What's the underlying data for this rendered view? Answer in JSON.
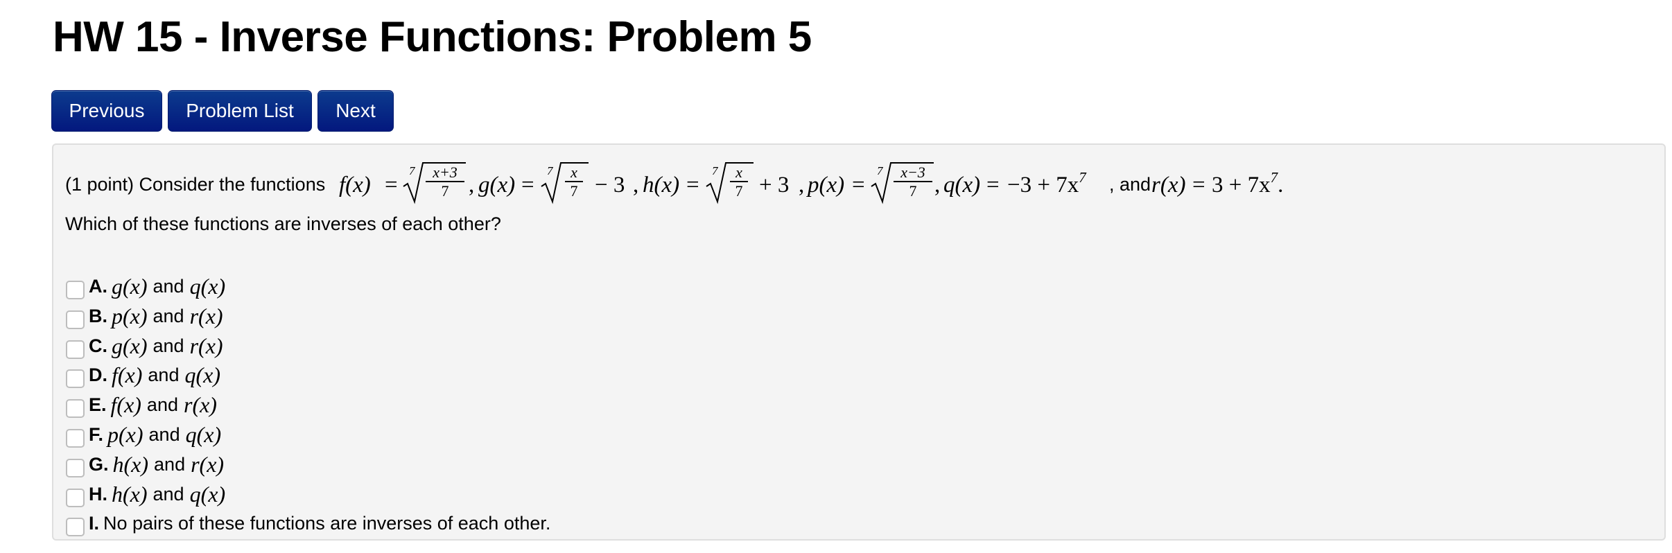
{
  "page_title": "HW 15 - Inverse Functions: Problem 5",
  "nav": {
    "previous_label": "Previous",
    "problem_list_label": "Problem List",
    "next_label": "Next",
    "button_color": "#0a2a86"
  },
  "problem": {
    "intro": "(1 point) Consider the functions",
    "functions": {
      "f": {
        "name": "f(x)",
        "expr": "√[7]((x+3)/7)",
        "index": "7",
        "numerator": "x+3",
        "denominator": "7",
        "suffix": ""
      },
      "g": {
        "name": "g(x)",
        "expr": "√[7](x/7) − 3",
        "index": "7",
        "numerator": "x",
        "denominator": "7",
        "suffix": "− 3"
      },
      "h": {
        "name": "h(x)",
        "expr": "√[7](x/7) + 3",
        "index": "7",
        "numerator": "x",
        "denominator": "7",
        "suffix": "+ 3"
      },
      "p": {
        "name": "p(x)",
        "expr": "√[7]((x−3)/7)",
        "index": "7",
        "numerator": "x−3",
        "denominator": "7",
        "suffix": ""
      },
      "q": {
        "name": "q(x)",
        "expr": "−3 + 7x^7",
        "base": "−3 + 7x",
        "exp": "7"
      },
      "r": {
        "name": "r(x)",
        "expr": "3 + 7x^7",
        "base": "3 + 7x",
        "exp": "7"
      }
    },
    "and_word": "and",
    "question": "Which of these functions are inverses of each other?",
    "options": [
      {
        "letter": "A.",
        "first": "g(x)",
        "conj": "and",
        "second": "q(x)",
        "checked": false
      },
      {
        "letter": "B.",
        "first": "p(x)",
        "conj": "and",
        "second": "r(x)",
        "checked": false
      },
      {
        "letter": "C.",
        "first": "g(x)",
        "conj": "and",
        "second": "r(x)",
        "checked": false
      },
      {
        "letter": "D.",
        "first": "f(x)",
        "conj": "and",
        "second": "q(x)",
        "checked": false
      },
      {
        "letter": "E.",
        "first": "f(x)",
        "conj": "and",
        "second": "r(x)",
        "checked": false
      },
      {
        "letter": "F.",
        "first": "p(x)",
        "conj": "and",
        "second": "q(x)",
        "checked": false
      },
      {
        "letter": "G.",
        "first": "h(x)",
        "conj": "and",
        "second": "r(x)",
        "checked": false
      },
      {
        "letter": "H.",
        "first": "h(x)",
        "conj": "and",
        "second": "q(x)",
        "checked": false
      },
      {
        "letter": "I.",
        "text": "No pairs of these functions are inverses of each other.",
        "checked": false
      }
    ]
  }
}
